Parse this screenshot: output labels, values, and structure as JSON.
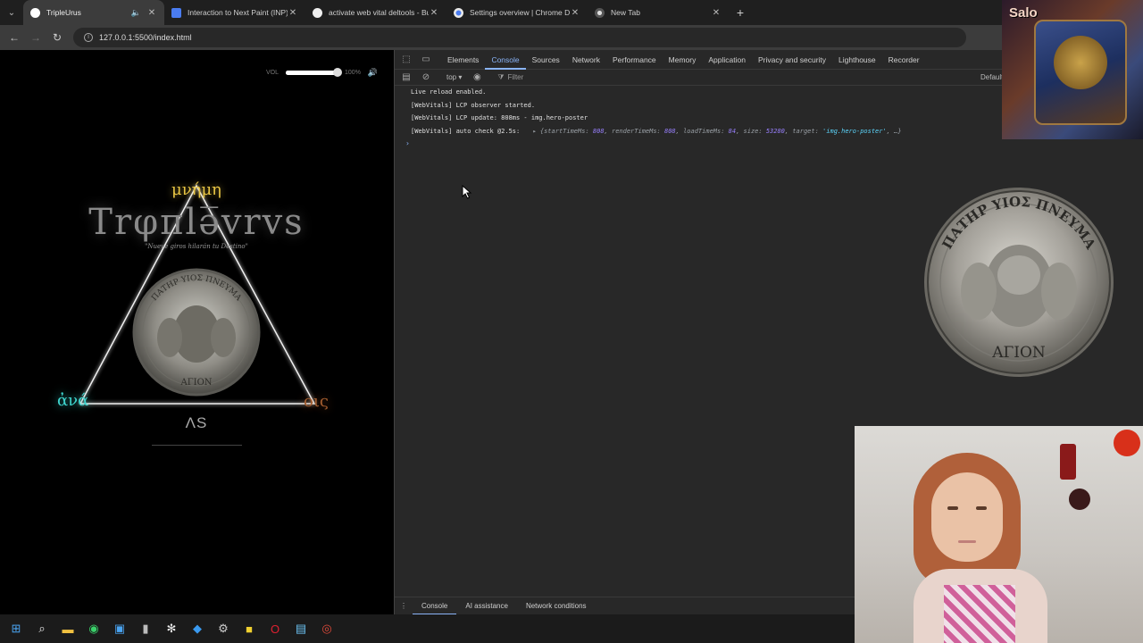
{
  "browser": {
    "tabs": [
      {
        "title": "TripleUrus",
        "favicon_color": "#ffffff",
        "active": true,
        "audio": true
      },
      {
        "title": "Interaction to Next Paint (INP)",
        "favicon_color": "#4a7cf0",
        "active": false
      },
      {
        "title": "activate web vital deltools - Bu",
        "favicon_color": "#eeeeee",
        "active": false
      },
      {
        "title": "Settings overview | Chrome D",
        "favicon_color": "#4a7cf0",
        "active": false
      },
      {
        "title": "New Tab",
        "favicon_color": "#dddddd",
        "active": false
      }
    ],
    "url": "127.0.0.1:5500/index.html"
  },
  "page": {
    "volume_label": "VOL",
    "volume_level": 1.0,
    "volume_pct": "100%",
    "mneme": "μνήμη",
    "brand": "Trφπlə̅vrvs",
    "tagline": "\"Nueve giros hilarán tu Destino\"",
    "ana": "ἀνά",
    "ois": "οις",
    "as": "ΛS",
    "coin_top": "ΠΑΤΗΡ ΥΙΟΣ ΠΝΕΥΜΑ",
    "coin_bottom": "ΑΓΙΟΝ"
  },
  "devtools": {
    "tabs": [
      "Elements",
      "Console",
      "Sources",
      "Network",
      "Performance",
      "Memory",
      "Application",
      "Privacy and security",
      "Lighthouse",
      "Recorder"
    ],
    "active_tab": "Console",
    "context": "top ▾",
    "filter_placeholder": "Filter",
    "levels": "Default",
    "logs": [
      "Live reload enabled.",
      "[WebVitals] LCP observer started.",
      "[WebVitals] LCP update: 808ms - img.hero-poster",
      "[WebVitals] auto check @2.5s:"
    ],
    "log_object": {
      "arrow": "▸",
      "open": "{startTimeMs: ",
      "v1": "808",
      "k2": ", renderTimeMs: ",
      "v2": "808",
      "k3": ", loadTimeMs: ",
      "v3": "84",
      "k4": ", size: ",
      "v4": "53280",
      "k5": ", target: ",
      "v5": "'img.hero-poster'",
      "close": ", …}"
    },
    "prompt": "›",
    "drawer_tabs": [
      "Console",
      "AI assistance",
      "Network conditions"
    ]
  },
  "overlay": {
    "streamer_nick": "Salo"
  },
  "taskbar": {
    "icons": [
      {
        "name": "windows-start-icon",
        "glyph": "⊞",
        "color": "#4aa3f0"
      },
      {
        "name": "search-icon",
        "glyph": "⌕",
        "color": "#eeeeee"
      },
      {
        "name": "file-explorer-icon",
        "glyph": "▬",
        "color": "#f0c040"
      },
      {
        "name": "whatsapp-icon",
        "glyph": "◉",
        "color": "#3ad06a"
      },
      {
        "name": "app-window-icon",
        "glyph": "▣",
        "color": "#4aa3f0"
      },
      {
        "name": "terminal-icon",
        "glyph": "▮",
        "color": "#bbbbbb"
      },
      {
        "name": "chatgpt-icon",
        "glyph": "✻",
        "color": "#eeeeee"
      },
      {
        "name": "vscode-icon",
        "glyph": "◆",
        "color": "#3a9af0"
      },
      {
        "name": "settings-gear-icon",
        "glyph": "⚙",
        "color": "#cccccc"
      },
      {
        "name": "sticky-notes-icon",
        "glyph": "■",
        "color": "#f0d030"
      },
      {
        "name": "opera-icon",
        "glyph": "O",
        "color": "#e02030"
      },
      {
        "name": "notepad-icon",
        "glyph": "▤",
        "color": "#6ac0f0"
      },
      {
        "name": "chrome-icon",
        "glyph": "◎",
        "color": "#e04a3a"
      }
    ]
  }
}
